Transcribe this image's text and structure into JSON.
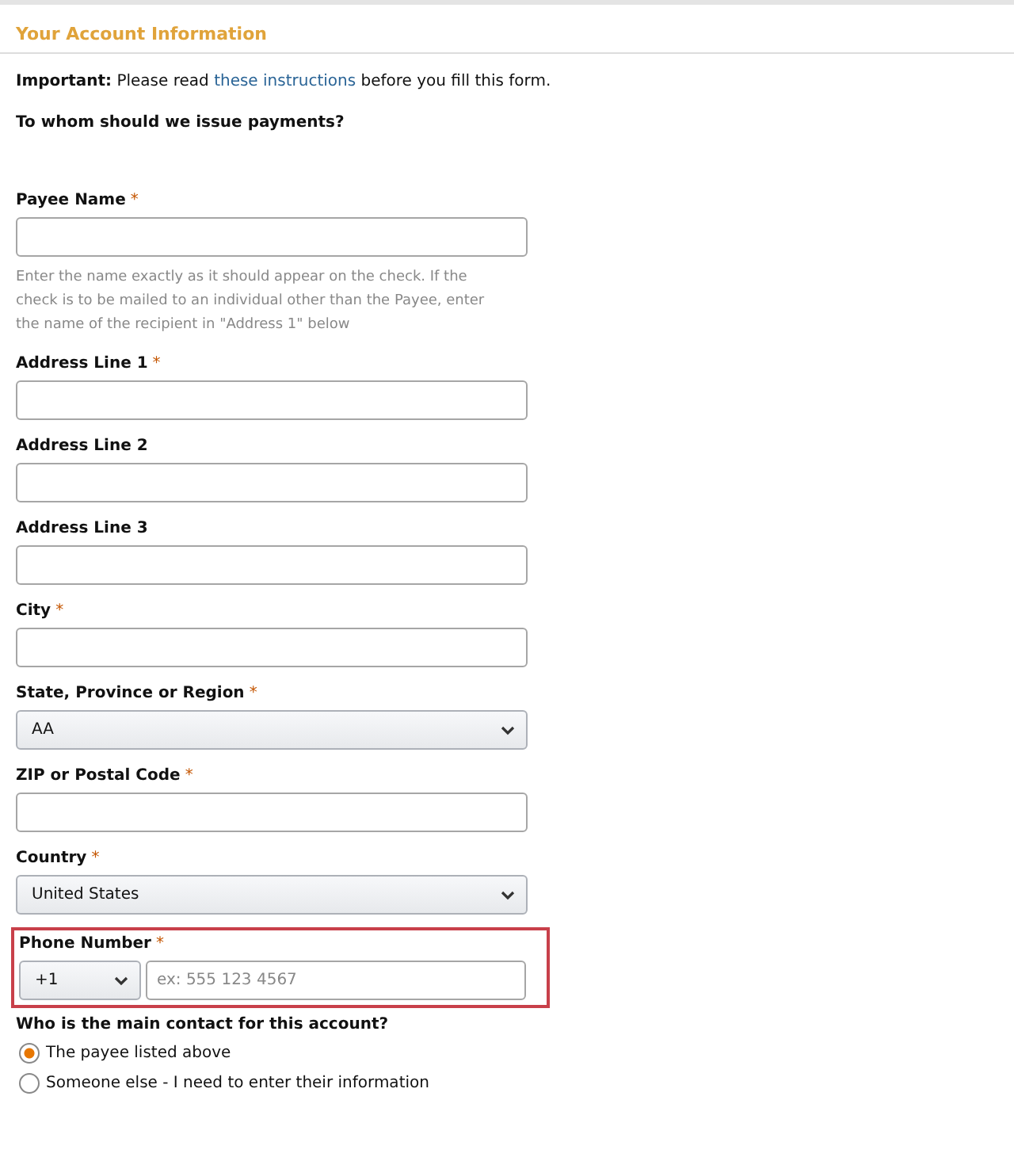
{
  "header": {
    "title": "Your Account Information"
  },
  "notice": {
    "lead": "Important:",
    "before": "Please read",
    "link": "these instructions",
    "after": "before you fill this form."
  },
  "question": "To whom should we issue payments?",
  "fields": [
    {
      "kind": "text",
      "label": "Payee Name",
      "required_mark": "*",
      "hint": "Enter the name exactly as it should appear on the check. If the check is to be mailed to an individual other than the Payee, enter the name of the recipient in \"Address 1\" below"
    },
    {
      "kind": "text",
      "label": "Address Line 1",
      "required_mark": "*"
    },
    {
      "kind": "text",
      "label": "Address Line 2"
    },
    {
      "kind": "text",
      "label": "Address Line 3"
    },
    {
      "kind": "text",
      "label": "City",
      "required_mark": "*"
    },
    {
      "kind": "select",
      "label": "State, Province or Region",
      "required_mark": "*",
      "value": "AA"
    },
    {
      "kind": "text",
      "label": "ZIP or Postal Code",
      "required_mark": "*"
    },
    {
      "kind": "select",
      "label": "Country",
      "required_mark": "*",
      "value": "United States"
    },
    {
      "kind": "phone",
      "label": "Phone Number",
      "required_mark": "*",
      "code": "+1",
      "placeholder": "ex: 555 123 4567",
      "highlighted": true
    }
  ],
  "contact": {
    "question": "Who is the main contact for this account?",
    "options": [
      {
        "label": "The payee listed above",
        "selected": true
      },
      {
        "label": "Someone else - I need to enter their information",
        "selected": false
      }
    ]
  }
}
